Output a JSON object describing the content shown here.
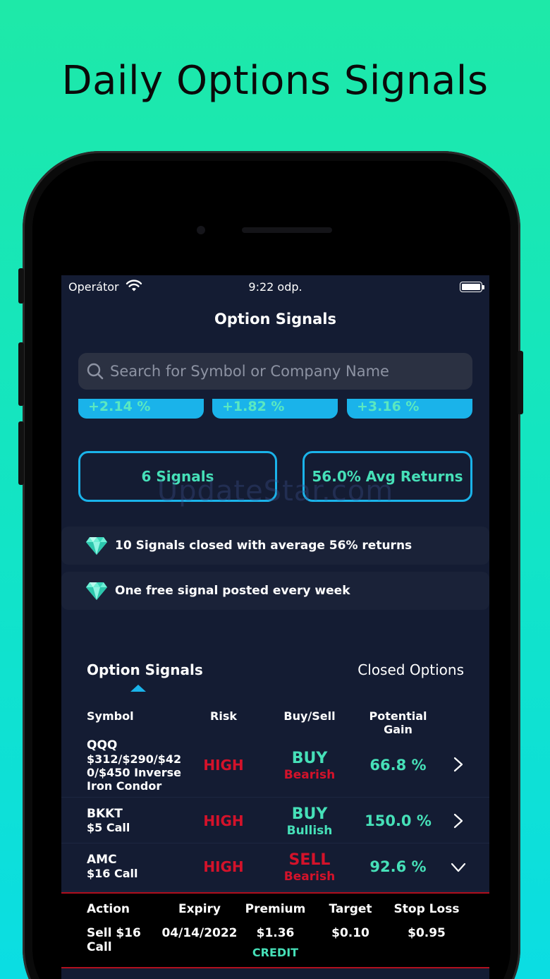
{
  "headline": "Daily Options Signals",
  "status_bar": {
    "carrier": "Operátor",
    "time": "9:22 odp."
  },
  "nav": {
    "title": "Option Signals"
  },
  "search": {
    "placeholder": "Search for Symbol or Company Name"
  },
  "performance_pills": [
    "+2.14 %",
    "+1.82 %",
    "+3.16 %"
  ],
  "stats": {
    "signals": "6 Signals",
    "avg_returns": "56.0% Avg Returns"
  },
  "watermark": "UpdateStar.com",
  "notes": [
    "10 Signals closed with average 56% returns",
    "One free signal posted every week"
  ],
  "tabs": {
    "active": "Option Signals",
    "other": "Closed Options"
  },
  "table": {
    "headers": {
      "symbol": "Symbol",
      "risk": "Risk",
      "buy_sell": "Buy/Sell",
      "gain": "Potential Gain"
    },
    "rows": [
      {
        "ticker": "QQQ",
        "l1": "$312/$290/$42",
        "l2": "0/$450 Inverse",
        "l3": "Iron Condor",
        "risk": "HIGH",
        "action": "BUY",
        "direction": "Bearish",
        "gain": "66.8 %"
      },
      {
        "ticker": "BKKT",
        "l1": "$5 Call",
        "risk": "HIGH",
        "action": "BUY",
        "direction": "Bullish",
        "gain": "150.0 %"
      },
      {
        "ticker": "AMC",
        "l1": "$16 Call",
        "risk": "HIGH",
        "action": "SELL",
        "direction": "Bearish",
        "gain": "92.6 %"
      }
    ]
  },
  "detail": {
    "headers": {
      "action": "Action",
      "expiry": "Expiry",
      "premium": "Premium",
      "target": "Target",
      "stop_loss": "Stop Loss"
    },
    "values": {
      "action_l1": "Sell $16",
      "action_l2": "Call",
      "expiry": "04/14/2022",
      "premium": "$1.36",
      "premium_type": "CREDIT",
      "target": "$0.10",
      "stop_loss": "$0.95"
    }
  },
  "colors": {
    "accent_blue": "#1ab3ea",
    "green": "#46e0b8",
    "red": "#d4122a",
    "background": "#141c33"
  }
}
